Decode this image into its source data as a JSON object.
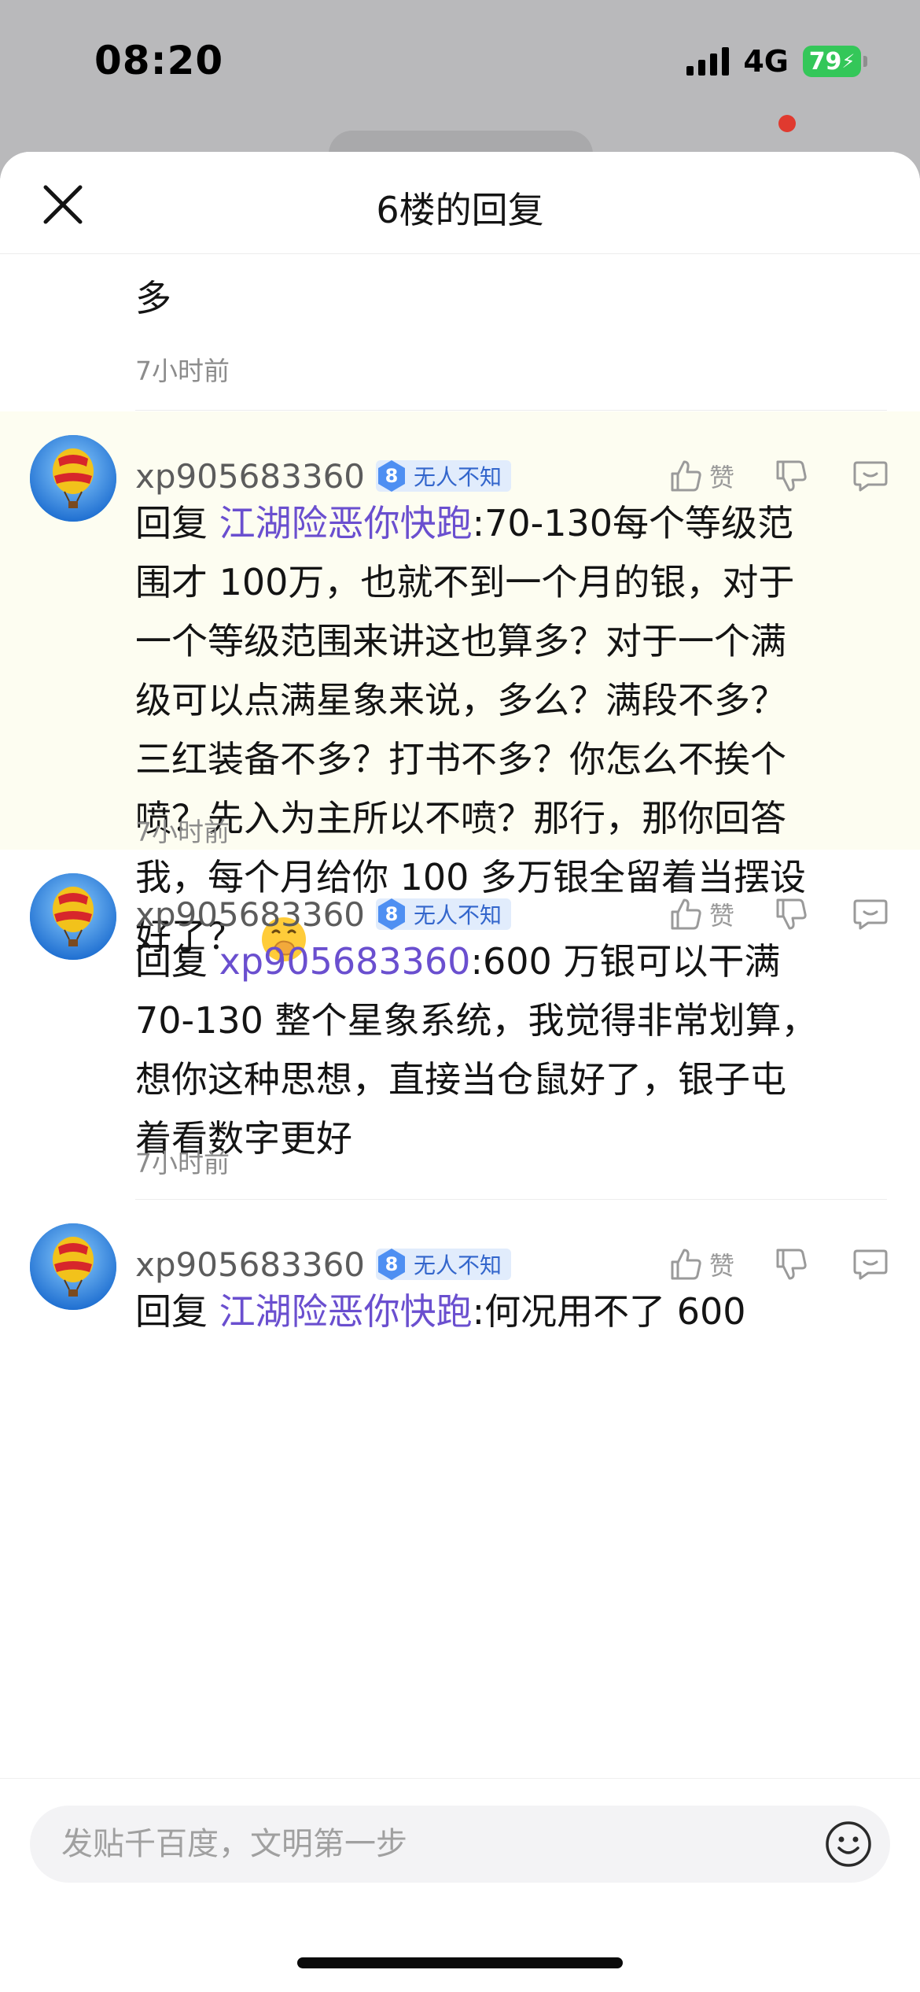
{
  "status_bar": {
    "time": "08:20",
    "network": "4G",
    "battery": "79"
  },
  "sheet": {
    "title": "6楼的回复"
  },
  "partial_reply": {
    "text_tail": "多",
    "time": "7小时前"
  },
  "replies": [
    {
      "username": "xp905683360",
      "level": "8",
      "badge": "无人不知",
      "like_label": "赞",
      "prefix": "回复 ",
      "mention": "江湖险恶你快跑",
      "lines": [
        ":70-130每个等级范",
        "围才 100万，也就不到一个月的银，对于",
        "一个等级范围来讲这也算多？对于一个满",
        "级可以点满星象来说，多么？满段不多？",
        "三红装备不多？打书不多？你怎么不挨个",
        "喷？先入为主所以不喷？那行，那你回答",
        "我，每个月给你 100 多万银全留着当摆设",
        "好了？"
      ],
      "emoji": "hand-over-mouth-emoji",
      "time": "7小时前"
    },
    {
      "username": "xp905683360",
      "level": "8",
      "badge": "无人不知",
      "like_label": "赞",
      "prefix": "回复 ",
      "mention": "xp905683360",
      "lines": [
        ":600 万银可以干满",
        "70-130 整个星象系统，我觉得非常划算，",
        "想你这种思想，直接当仓鼠好了，银子屯",
        "着看数字更好"
      ],
      "time": "7小时前"
    },
    {
      "username": "xp905683360",
      "level": "8",
      "badge": "无人不知",
      "like_label": "赞",
      "prefix": "回复 ",
      "mention": "江湖险恶你快跑",
      "lines": [
        ":何况用不了 600"
      ]
    }
  ],
  "input": {
    "placeholder": "发贴千百度，文明第一步"
  },
  "icons": {
    "close": "close-icon",
    "like": "thumbs-up-icon",
    "dislike": "thumbs-down-icon",
    "comment": "comment-icon",
    "emoji": "smile-icon",
    "avatar": "hot-air-balloon-avatar"
  },
  "colors": {
    "mention": "#6a4fcf",
    "badge_text": "#3366cc",
    "badge_bg": "#e1ecfc",
    "highlight_bg": "#fdfdf1",
    "battery": "#34c759"
  }
}
